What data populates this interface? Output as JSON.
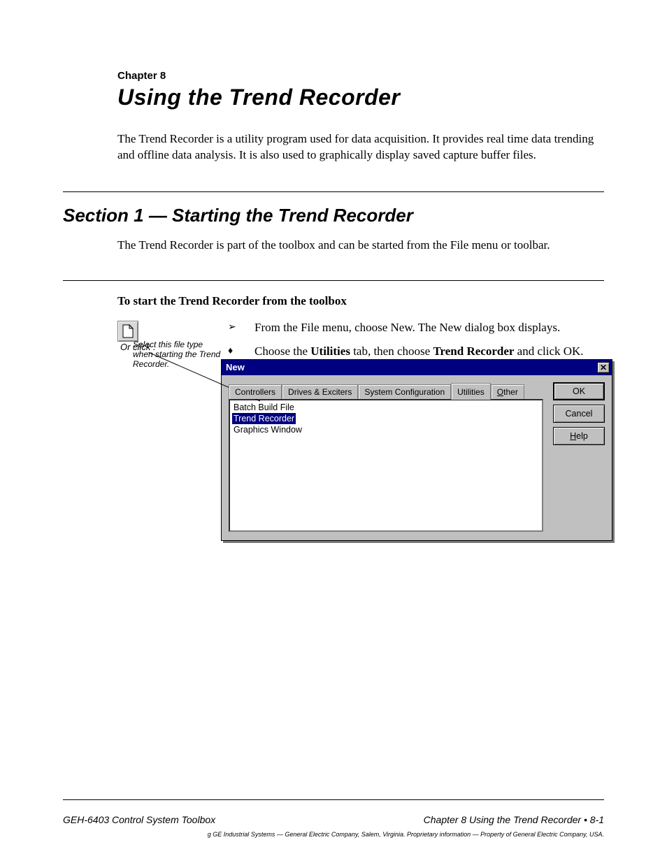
{
  "chapter": "Chapter 8",
  "page_title": "Using the Trend Recorder",
  "intro": "The Trend Recorder is a utility program used for data acquisition. It provides real time data trending and offline data analysis. It is also used to graphically display saved capture buffer files.",
  "section1": {
    "heading": "Section 1 — Starting the Trend Recorder",
    "body": "The Trend Recorder is part of the toolbox and can be started from the File menu or toolbar."
  },
  "procedure_heading": "To start the Trend Recorder from the toolbox",
  "steps": {
    "s1": "From the File menu, choose New. The New dialog box displays.",
    "s2_prefix": "Choose the ",
    "s2_bold1": "Utilities",
    "s2_mid": " tab, then choose ",
    "s2_bold2": "Trend Recorder",
    "s2_suffix": " and click OK."
  },
  "or_label": "Or click      .",
  "callout": "Select this file type when starting the Trend Recorder.",
  "dialog": {
    "title": "New",
    "tabs": [
      "Controllers",
      "Drives & Exciters",
      "System Configuration",
      "Utilities",
      "Other"
    ],
    "active_tab_index": 3,
    "items": [
      "Batch Build File",
      "Trend Recorder",
      "Graphics Window"
    ],
    "selected_index": 1,
    "buttons": {
      "ok": "OK",
      "cancel": "Cancel",
      "help": "Help"
    }
  },
  "footer": {
    "left": "GEH-6403 Control System Toolbox",
    "right": "Chapter 8 Using the Trend Recorder",
    "page": "• 8-1"
  },
  "legal": "g  GE Industrial Systems — General Electric Company, Salem, Virginia. Proprietary information — Property of General Electric Company, USA."
}
